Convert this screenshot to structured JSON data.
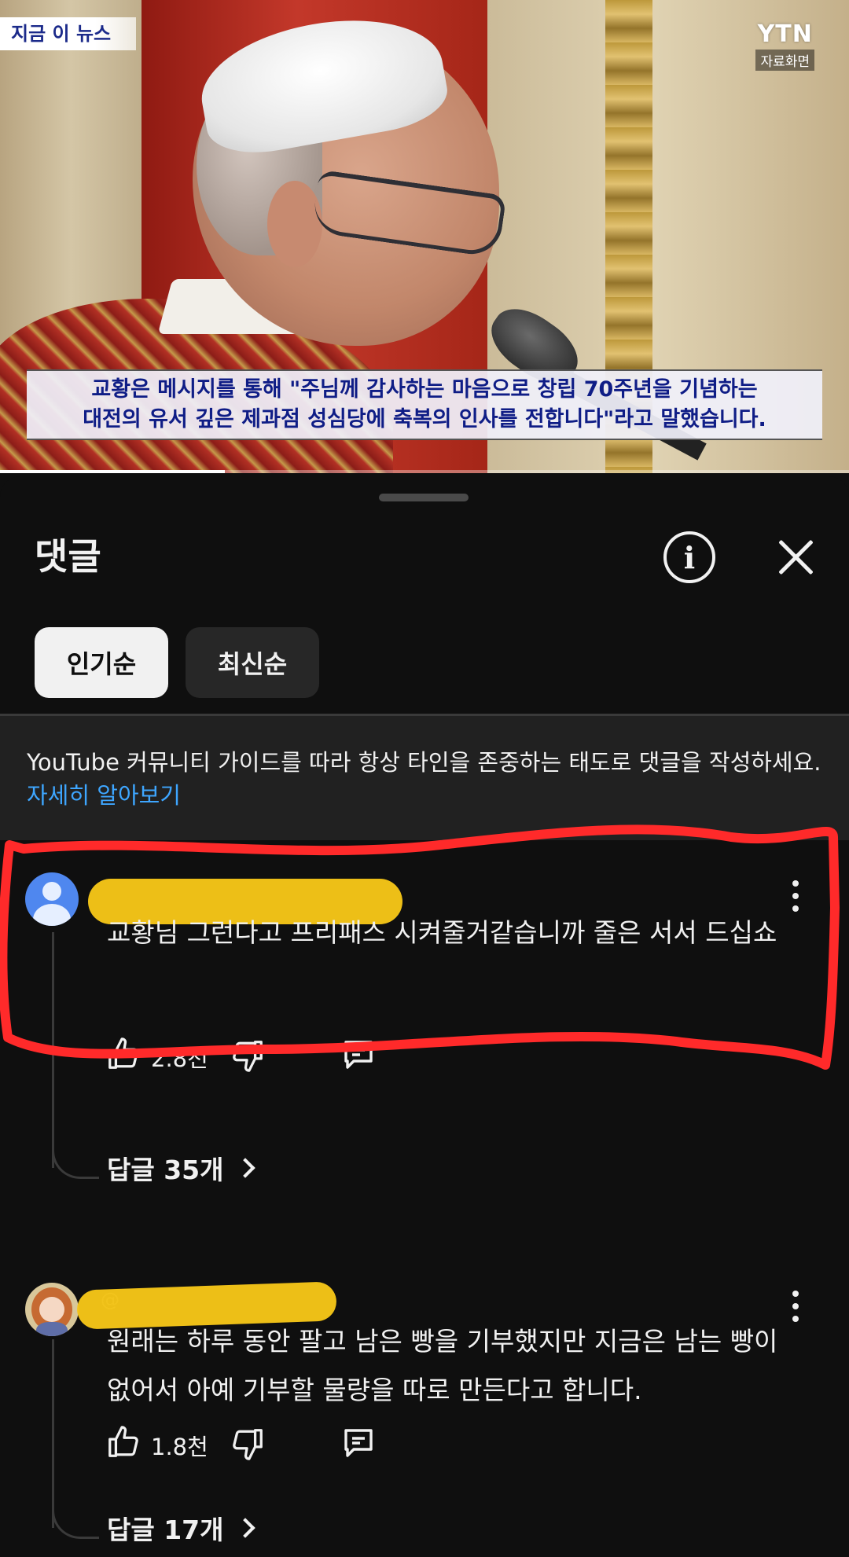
{
  "video": {
    "news_tag": "지금 이 뉴스",
    "channel_logo": "YTN",
    "channel_sub": "자료화면",
    "subtitle_line1": "교황은 메시지를 통해 \"주님께 감사하는 마음으로 창립 70주년을 기념하는",
    "subtitle_line2": "대전의 유서 깊은 제과점 성심당에 축복의 인사를 전합니다\"라고 말했습니다.",
    "progress_fraction": 0.265
  },
  "sheet": {
    "title": "댓글",
    "info_icon": "info-icon",
    "close_icon": "close-icon",
    "sort_chips": [
      {
        "label": "인기순",
        "selected": true
      },
      {
        "label": "최신순",
        "selected": false
      }
    ],
    "guideline_text": "YouTube 커뮤니티 가이드를 따라 항상 타인을 존중하는 태도로 댓글을 작성하세요.",
    "guideline_link": "자세히 알아보기"
  },
  "comments": [
    {
      "author": "",
      "text": "교황님 그런다고 프리패스 시켜줄거같습니까 줄은 서서 드십쇼",
      "likes": "2.8천",
      "replies": "답글 35개",
      "avatar": "default-avatar-icon"
    },
    {
      "author": "@",
      "text": "원래는 하루 동안 팔고 남은 빵을 기부했지만 지금은 남는 빵이 없어서 아예 기부할 물량을 따로 만든다고 합니다.",
      "likes": "1.8천",
      "replies": "답글 17개",
      "avatar": "cartoon-avatar-icon"
    }
  ],
  "colors": {
    "background": "#0f0f0f",
    "link": "#3ea6ff",
    "redaction": "#f5c518",
    "annotation": "#ff2a2a"
  }
}
